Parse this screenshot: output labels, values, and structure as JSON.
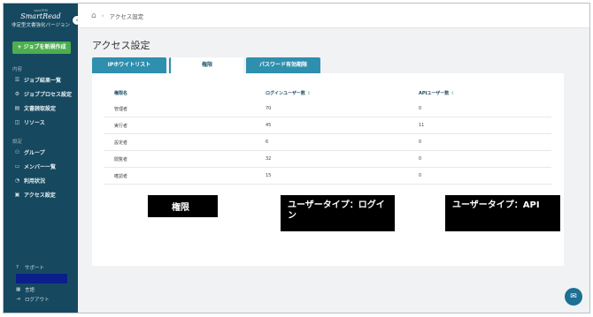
{
  "sidebar": {
    "logo_small": "cocoTEM",
    "logo_main": "SmartRead",
    "logo_sub": "非定型文書強化バージョン",
    "new_job_label": "+ ジョブを新規作成",
    "section_content": "内容",
    "content_items": [
      {
        "icon": "list-icon",
        "glyph": "☰",
        "label": "ジョブ結果一覧"
      },
      {
        "icon": "process-icon",
        "glyph": "⚙",
        "label": "ジョブプロセス設定"
      },
      {
        "icon": "document-icon",
        "glyph": "▤",
        "label": "文書読取設定"
      },
      {
        "icon": "resource-icon",
        "glyph": "◫",
        "label": "リソース"
      }
    ],
    "section_settings": "設定",
    "settings_items": [
      {
        "icon": "group-icon",
        "glyph": "⚇",
        "label": "グループ"
      },
      {
        "icon": "member-icon",
        "glyph": "▭",
        "label": "メンバー一覧"
      },
      {
        "icon": "usage-icon",
        "glyph": "◔",
        "label": "利用状況"
      },
      {
        "icon": "access-icon",
        "glyph": "▣",
        "label": "アクセス設定"
      }
    ],
    "support_label": "サポート",
    "language_label": "言語",
    "logout_label": "ログアウト"
  },
  "header": {
    "breadcrumb": "アクセス設定"
  },
  "main": {
    "title": "アクセス設定",
    "tabs": [
      {
        "label": "IPホワイトリスト"
      },
      {
        "label": "権限"
      },
      {
        "label": "パスワード有効期限"
      }
    ],
    "table": {
      "headers": [
        "権限名",
        "ログインユーザー数",
        "APIユーザー数"
      ],
      "sort_glyph": "⇕",
      "rows": [
        [
          "管理者",
          "70",
          "0"
        ],
        [
          "実行者",
          "45",
          "11"
        ],
        [
          "設定者",
          "6",
          "0"
        ],
        [
          "閲覧者",
          "32",
          "0"
        ],
        [
          "確認者",
          "15",
          "0"
        ]
      ]
    }
  },
  "annotations": [
    {
      "text": "権限"
    },
    {
      "text": "ユーザータイプ：ログイン"
    },
    {
      "text": "ユーザータイプ：API"
    }
  ],
  "colors": {
    "sidebar": "#16495f",
    "accent": "#2f8fae",
    "new_job": "#4cae4f"
  }
}
